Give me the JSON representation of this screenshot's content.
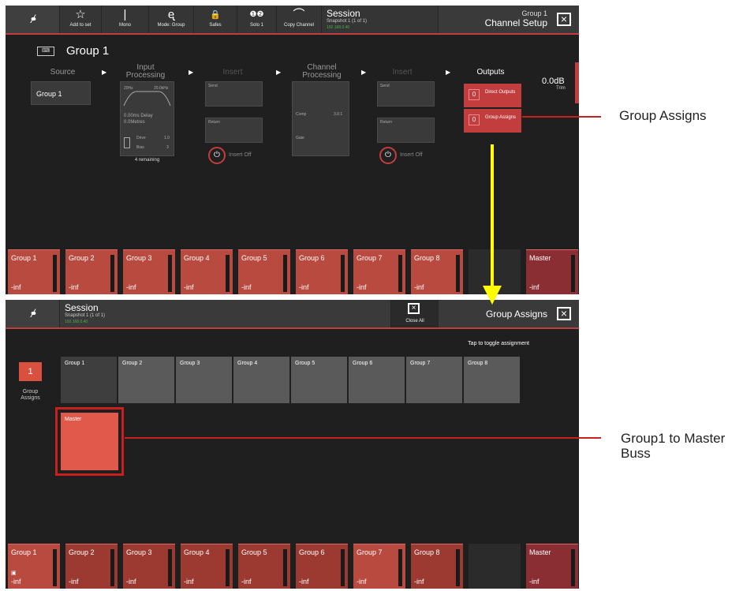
{
  "top": {
    "toolbar": {
      "logo": "•∕•",
      "buttons": [
        {
          "icon": "☆",
          "label": "Add to set"
        },
        {
          "icon": "|",
          "label": "Mono"
        },
        {
          "icon": "ᶒ",
          "label": "Mode: Group"
        },
        {
          "icon": "🔒",
          "label": "Safes"
        },
        {
          "icon": "❶❷",
          "label": "Solo 1"
        },
        {
          "icon": "⌒",
          "label": "Copy Channel"
        }
      ],
      "session_title": "Session",
      "session_sub": "Snapshot 1 (1 of 1)",
      "session_ip": "192.168.0.40",
      "right_title": "Group 1",
      "right_subtitle": "Channel Setup"
    },
    "group_title": "Group 1",
    "source_label": "Source",
    "source_value": "Group 1",
    "input_processing": "Input Processing",
    "hpf": "20Hz",
    "lpf": "20.0kHz",
    "delay": "0.00ms Delay",
    "delay2": "0.0Metres",
    "drive_label": "Drive",
    "drive_value": "1.0",
    "bias_label": "Bias",
    "bias_value": "3",
    "remaining": "4 remaining",
    "insert1": "Insert",
    "send_label": "Send",
    "return_label": "Return",
    "insert_off": "Insert Off",
    "channel_processing": "Channel Processing",
    "comp_label": "Comp",
    "comp_value": "3.0:1",
    "gate_label": "Gate",
    "insert2": "Insert",
    "outputs": "Outputs",
    "direct_outputs": "Direct Outputs",
    "group_assigns": "Group Assigns",
    "zero": "0",
    "trim_value": "0.0dB",
    "trim_label": "Trim"
  },
  "bottom": {
    "session_title": "Session",
    "session_sub": "Snapshot 1 (1 of 1)",
    "session_ip": "192.168.0.40",
    "close_all": "Close All",
    "right_title": "Group Assigns",
    "hint": "Tap to toggle assignment",
    "side_count": "1",
    "side_label": "Group Assigns",
    "groups": [
      "Group 1",
      "Group 2",
      "Group 3",
      "Group 4",
      "Group 5",
      "Group 6",
      "Group 7",
      "Group 8"
    ],
    "master": "Master"
  },
  "strips": [
    {
      "name": "Group 1",
      "value": "-inf"
    },
    {
      "name": "Group 2",
      "value": "-inf"
    },
    {
      "name": "Group 3",
      "value": "-inf"
    },
    {
      "name": "Group 4",
      "value": "-inf"
    },
    {
      "name": "Group 5",
      "value": "-inf"
    },
    {
      "name": "Group 6",
      "value": "-inf"
    },
    {
      "name": "Group 7",
      "value": "-inf"
    },
    {
      "name": "Group 8",
      "value": "-inf"
    },
    {
      "name": "",
      "value": ""
    },
    {
      "name": "Master",
      "value": "-inf"
    }
  ],
  "annotations": {
    "group_assigns": "Group Assigns",
    "group_to_master": "Group1 to Master Buss"
  },
  "colors": {
    "accent": "#c23d3d",
    "strip": "#b94a3f",
    "arrow": "#ffff00"
  }
}
